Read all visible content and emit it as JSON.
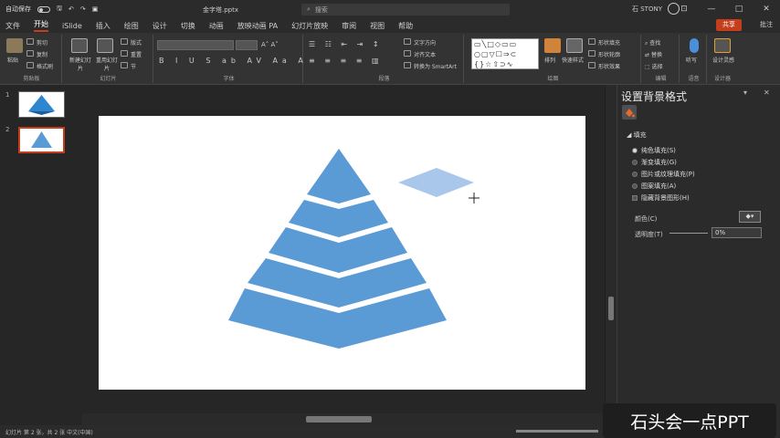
{
  "titlebar": {
    "autosave": "自动保存",
    "doc_title": "金字塔.pptx",
    "search_placeholder": "搜索",
    "user": "石 STONY",
    "win_min": "—",
    "win_max": "□",
    "win_close": "✕"
  },
  "tabs": [
    "文件",
    "开始",
    "iSlide",
    "插入",
    "绘图",
    "设计",
    "切换",
    "动画",
    "放映动画 PA",
    "幻灯片放映",
    "审阅",
    "视图",
    "帮助"
  ],
  "share": "共享",
  "comment": "批注",
  "ribbon": {
    "groups": [
      "剪贴板",
      "幻灯片",
      "字体",
      "段落",
      "绘图",
      "编辑",
      "语音",
      "设计器"
    ],
    "paste": "粘贴",
    "cut": "剪切",
    "copy": "复制",
    "format_painter": "格式刷",
    "new_slide": "新建幻灯片",
    "reuse": "重用幻灯片",
    "layout": "版式",
    "reset": "重置",
    "section": "节",
    "text_direction": "文字方向",
    "align_text": "对齐文本",
    "smartart": "转换为 SmartArt",
    "arrange": "排列",
    "quick_styles": "快速样式",
    "shape_fill": "形状填充",
    "shape_outline": "形状轮廓",
    "shape_effects": "形状效果",
    "find": "查找",
    "replace": "替换",
    "select": "选择",
    "dictate": "听写",
    "design_ideas": "设计灵感"
  },
  "thumbs": [
    {
      "num": "1"
    },
    {
      "num": "2"
    }
  ],
  "pane": {
    "title": "设置背景格式",
    "section": "填充",
    "options": [
      {
        "label": "纯色填充(S)",
        "on": true
      },
      {
        "label": "渐变填充(G)",
        "on": false
      },
      {
        "label": "图片或纹理填充(P)",
        "on": false
      },
      {
        "label": "图案填充(A)",
        "on": false
      }
    ],
    "hide_bg": "隐藏背景图形(H)",
    "color_label": "颜色(C)",
    "transparency_label": "透明度(T)",
    "transparency_value": "0%"
  },
  "status": {
    "text": "幻灯片 第 2 张，共 2 张   中文(中国)"
  },
  "watermark": "石头会一点PPT",
  "colors": {
    "accent": "#c43e1c",
    "pyramid": "#5b9bd5",
    "ghost": "#a9c7ea"
  }
}
